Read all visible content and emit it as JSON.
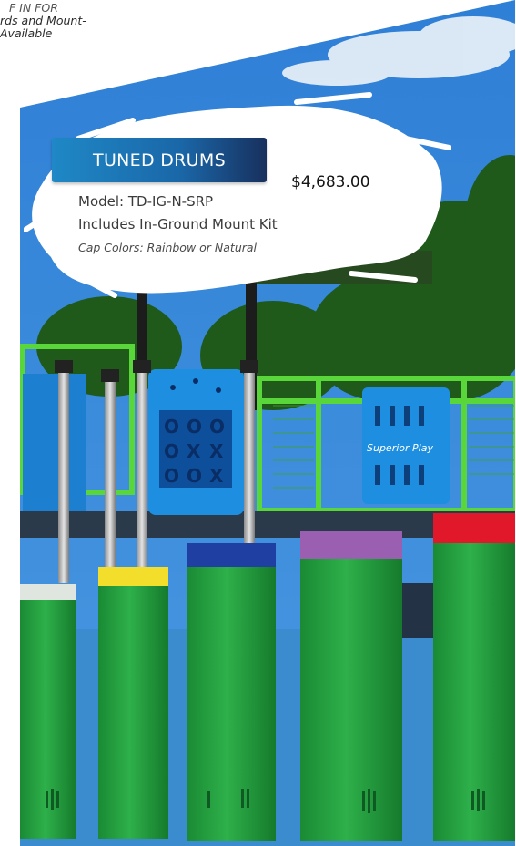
{
  "top_note": {
    "cut_line": "F IN FOR",
    "line1": "rds and Mount-",
    "line2": "Available"
  },
  "product": {
    "title": "TUNED DRUMS",
    "price": "$4,683.00",
    "model": "Model: TD-IG-N-SRP",
    "includes": "Includes In-Ground Mount Kit",
    "cap_colors": "Cap Colors: Rainbow or Natural"
  },
  "photo": {
    "game_panel_tiles": [
      "O",
      "O",
      "O",
      "O",
      "X",
      "X",
      "O",
      "O",
      "X"
    ],
    "music_panel_brand": "Superior Play",
    "drum_cap_colors": [
      "#dfe6df",
      "#f3de2b",
      "#1f3fa3",
      "#9a5fb0",
      "#e0182a"
    ]
  }
}
